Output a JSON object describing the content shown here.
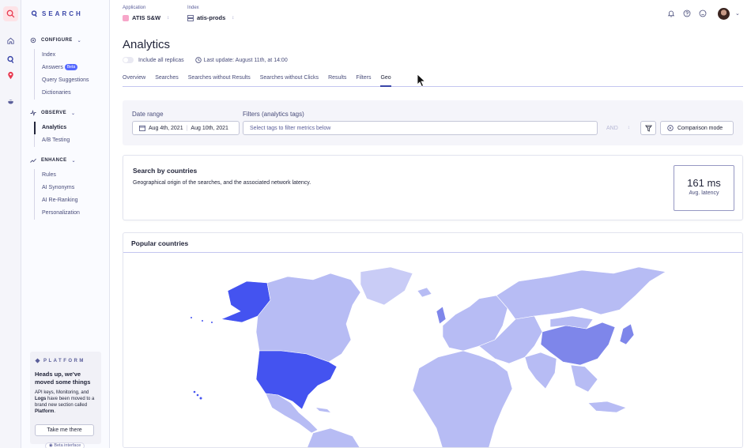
{
  "brand": {
    "name": "SEARCH"
  },
  "sidebar": {
    "sections": [
      {
        "label": "CONFIGURE",
        "items": [
          "Index",
          "Answers",
          "Query Suggestions",
          "Dictionaries"
        ]
      },
      {
        "label": "OBSERVE",
        "items": [
          "Analytics",
          "A/B Testing"
        ]
      },
      {
        "label": "ENHANCE",
        "items": [
          "Rules",
          "AI Synonyms",
          "AI Re-Ranking",
          "Personalization"
        ]
      }
    ],
    "answers_badge": "Beta",
    "active_item": "Analytics"
  },
  "platform": {
    "brand": "PLATFORM",
    "title": "Heads up, we've moved some things",
    "text_a": "API keys, Monitoring, and ",
    "text_logs": "Logs",
    "text_b": " have been moved to a brand new section called ",
    "text_platform": "Platform",
    "text_end": ".",
    "button": "Take me there",
    "beta_interface": "Beta interface"
  },
  "header": {
    "application_label": "Application",
    "application_value": "ATIS S&W",
    "index_label": "Index",
    "index_value": "atis-prods"
  },
  "page": {
    "title": "Analytics",
    "replicas_label": "Include all replicas",
    "last_update": "Last update: August 11th, at 14:00"
  },
  "tabs": [
    "Overview",
    "Searches",
    "Searches without Results",
    "Searches without Clicks",
    "Results",
    "Filters",
    "Geo"
  ],
  "active_tab": "Geo",
  "filters": {
    "date_label": "Date range",
    "date_start": "Aug 4th, 2021",
    "date_end": "Aug 10th, 2021",
    "tags_label": "Filters (analytics tags)",
    "tags_placeholder": "Select tags to filter metrics below",
    "and_label": "AND",
    "comparison_label": "Comparison mode"
  },
  "countries_card": {
    "title": "Search by countries",
    "subtitle": "Geographical origin of the searches, and the associated network latency.",
    "latency_value": "161 ms",
    "latency_label": "Avg. latency"
  },
  "map": {
    "title": "Popular countries",
    "colors": {
      "high": "#4453f0",
      "medium": "#7e86ea",
      "low": "#b7bcf4",
      "base": "#c9ccf6"
    }
  }
}
